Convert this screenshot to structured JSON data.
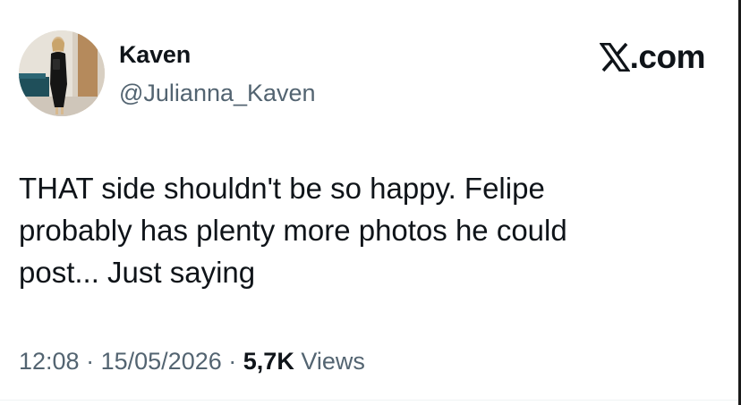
{
  "author": {
    "display_name": "Kaven",
    "handle": "@Julianna_Kaven",
    "avatar_icon": "profile-photo"
  },
  "brand": {
    "domain": "X.com",
    "icon": "x-logo-icon"
  },
  "tweet": {
    "text": "THAT  side shouldn't be so happy. Felipe\nprobably has plenty more photos he could\npost... Just saying"
  },
  "meta": {
    "time": "12:08",
    "separator": "·",
    "date": "15/05/2026",
    "views_count": "5,7K",
    "views_label": "Views"
  },
  "colors": {
    "text_primary": "#0f1419",
    "text_secondary": "#536471",
    "background": "#ffffff"
  }
}
